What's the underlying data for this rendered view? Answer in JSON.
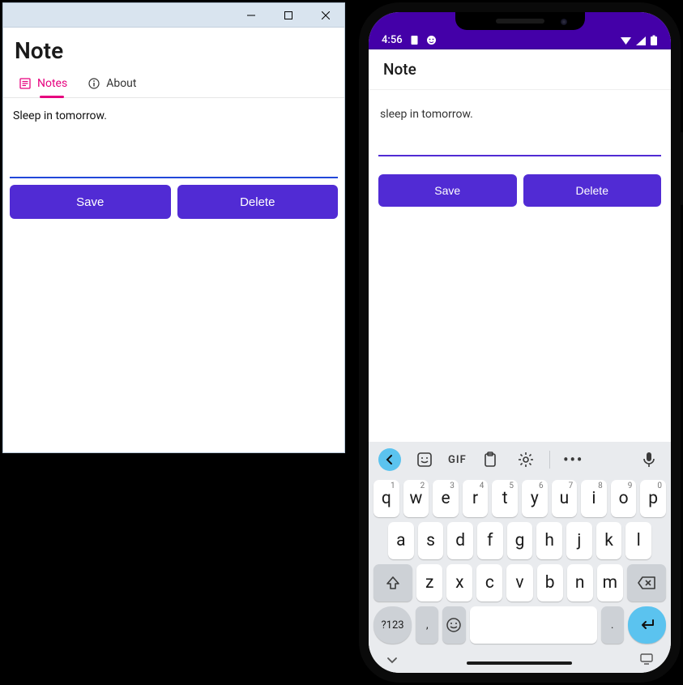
{
  "desktop": {
    "title": "Note",
    "tabs": [
      {
        "label": "Notes",
        "icon": "notes-icon",
        "active": true
      },
      {
        "label": "About",
        "icon": "info-icon",
        "active": false
      }
    ],
    "note_text": "Sleep in tomorrow.",
    "buttons": {
      "save": "Save",
      "delete": "Delete"
    }
  },
  "phone": {
    "status": {
      "time": "4:56",
      "icons_left": [
        "doc-icon",
        "face-icon"
      ],
      "icons_right": [
        "wifi-icon",
        "signal-icon",
        "battery-icon"
      ]
    },
    "app_title": "Note",
    "note_text": "sleep in tomorrow.",
    "buttons": {
      "save": "Save",
      "delete": "Delete"
    },
    "keyboard": {
      "toolbar_icons": [
        "back",
        "sticker",
        "gif",
        "clipboard",
        "gear",
        "sep",
        "more",
        "mic"
      ],
      "gif_label": "GIF",
      "row1": [
        {
          "k": "q",
          "s": "1"
        },
        {
          "k": "w",
          "s": "2"
        },
        {
          "k": "e",
          "s": "3"
        },
        {
          "k": "r",
          "s": "4"
        },
        {
          "k": "t",
          "s": "5"
        },
        {
          "k": "y",
          "s": "6"
        },
        {
          "k": "u",
          "s": "7"
        },
        {
          "k": "i",
          "s": "8"
        },
        {
          "k": "o",
          "s": "9"
        },
        {
          "k": "p",
          "s": "0"
        }
      ],
      "row2": [
        "a",
        "s",
        "d",
        "f",
        "g",
        "h",
        "j",
        "k",
        "l"
      ],
      "row3": [
        "z",
        "x",
        "c",
        "v",
        "b",
        "n",
        "m"
      ],
      "symbols_label": "?123",
      "comma": ",",
      "period": "."
    }
  },
  "colors": {
    "accent": "#512bd4",
    "tab_active": "#e6007e",
    "status_bg": "#4400a8"
  }
}
